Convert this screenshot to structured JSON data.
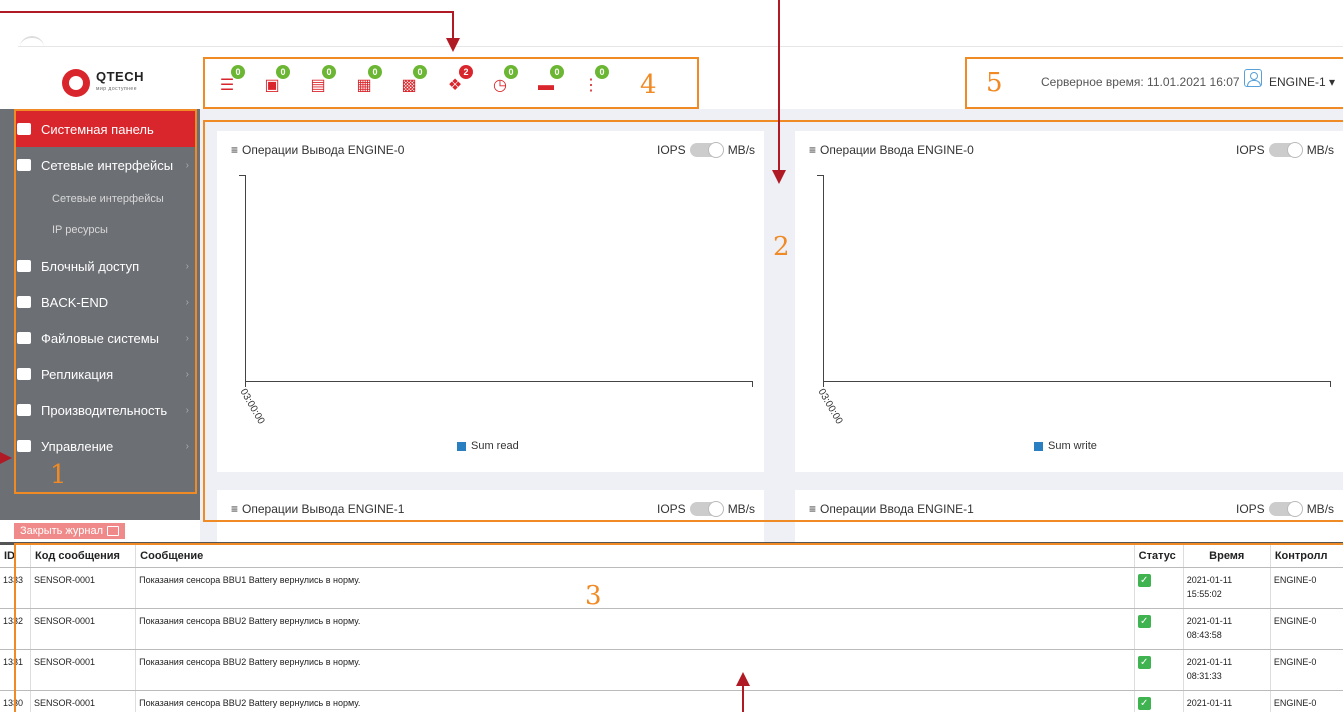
{
  "brand": {
    "name": "QTECH",
    "tagline": "мир доступнее"
  },
  "header": {
    "server_time_label": "Серверное время: 11.01.2021 16:07",
    "user": "ENGINE-1",
    "icons": [
      {
        "name": "storage-pool",
        "badge": "0",
        "status": "ok"
      },
      {
        "name": "disk",
        "badge": "0",
        "status": "ok"
      },
      {
        "name": "server",
        "badge": "0",
        "status": "ok"
      },
      {
        "name": "server-config",
        "badge": "0",
        "status": "ok"
      },
      {
        "name": "enclosure",
        "badge": "0",
        "status": "ok"
      },
      {
        "name": "signal",
        "badge": "2",
        "status": "alert"
      },
      {
        "name": "schedule",
        "badge": "0",
        "status": "ok"
      },
      {
        "name": "memory",
        "badge": "0",
        "status": "ok"
      },
      {
        "name": "replication",
        "badge": "0",
        "status": "ok"
      }
    ]
  },
  "callouts": {
    "c1": "1",
    "c2": "2",
    "c3": "3",
    "c4": "4",
    "c5": "5"
  },
  "sidebar": {
    "items": [
      {
        "label": "Системная панель",
        "active": true
      },
      {
        "label": "Сетевые интерфейсы"
      },
      {
        "label": "Блочный доступ"
      },
      {
        "label": "BACK-END"
      },
      {
        "label": "Файловые системы"
      },
      {
        "label": "Репликация"
      },
      {
        "label": "Производительность"
      },
      {
        "label": "Управление"
      }
    ],
    "subitems": [
      "Сетевые интерфейсы",
      "IP ресурсы"
    ]
  },
  "panels": [
    {
      "title": "Операции Вывода ENGINE-0",
      "toggle_left": "IOPS",
      "toggle_right": "MB/s",
      "legend": "Sum read",
      "x_tick": "03:00:00"
    },
    {
      "title": "Операции Ввода ENGINE-0",
      "toggle_left": "IOPS",
      "toggle_right": "MB/s",
      "legend": "Sum write",
      "x_tick": "03:00:00"
    },
    {
      "title": "Операции Вывода ENGINE-1",
      "toggle_left": "IOPS",
      "toggle_right": "MB/s"
    },
    {
      "title": "Операции Ввода ENGINE-1",
      "toggle_left": "IOPS",
      "toggle_right": "MB/s"
    }
  ],
  "log": {
    "close_label": "Закрыть журнал",
    "columns": [
      "ID",
      "Код сообщения",
      "Сообщение",
      "Статус",
      "Время",
      "Контролл"
    ],
    "rows": [
      {
        "id": "1333",
        "code": "SENSOR-0001",
        "message": "Показания сенсора BBU1 Battery вернулись в норму.",
        "date": "2021-01-11",
        "time": "15:55:02",
        "controller": "ENGINE-0"
      },
      {
        "id": "1332",
        "code": "SENSOR-0001",
        "message": "Показания сенсора BBU2 Battery вернулись в норму.",
        "date": "2021-01-11",
        "time": "08:43:58",
        "controller": "ENGINE-0"
      },
      {
        "id": "1331",
        "code": "SENSOR-0001",
        "message": "Показания сенсора BBU2 Battery вернулись в норму.",
        "date": "2021-01-11",
        "time": "08:31:33",
        "controller": "ENGINE-0"
      },
      {
        "id": "1330",
        "code": "SENSOR-0001",
        "message": "Показания сенсора BBU2 Battery вернулись в норму.",
        "date": "2021-01-11",
        "time": "",
        "controller": "ENGINE-0"
      }
    ]
  },
  "colors": {
    "accent": "#d9262c",
    "callout": "#f08a24",
    "sidebar": "#6c6f74",
    "ok": "#6bb633",
    "arrow": "#b01a24"
  }
}
